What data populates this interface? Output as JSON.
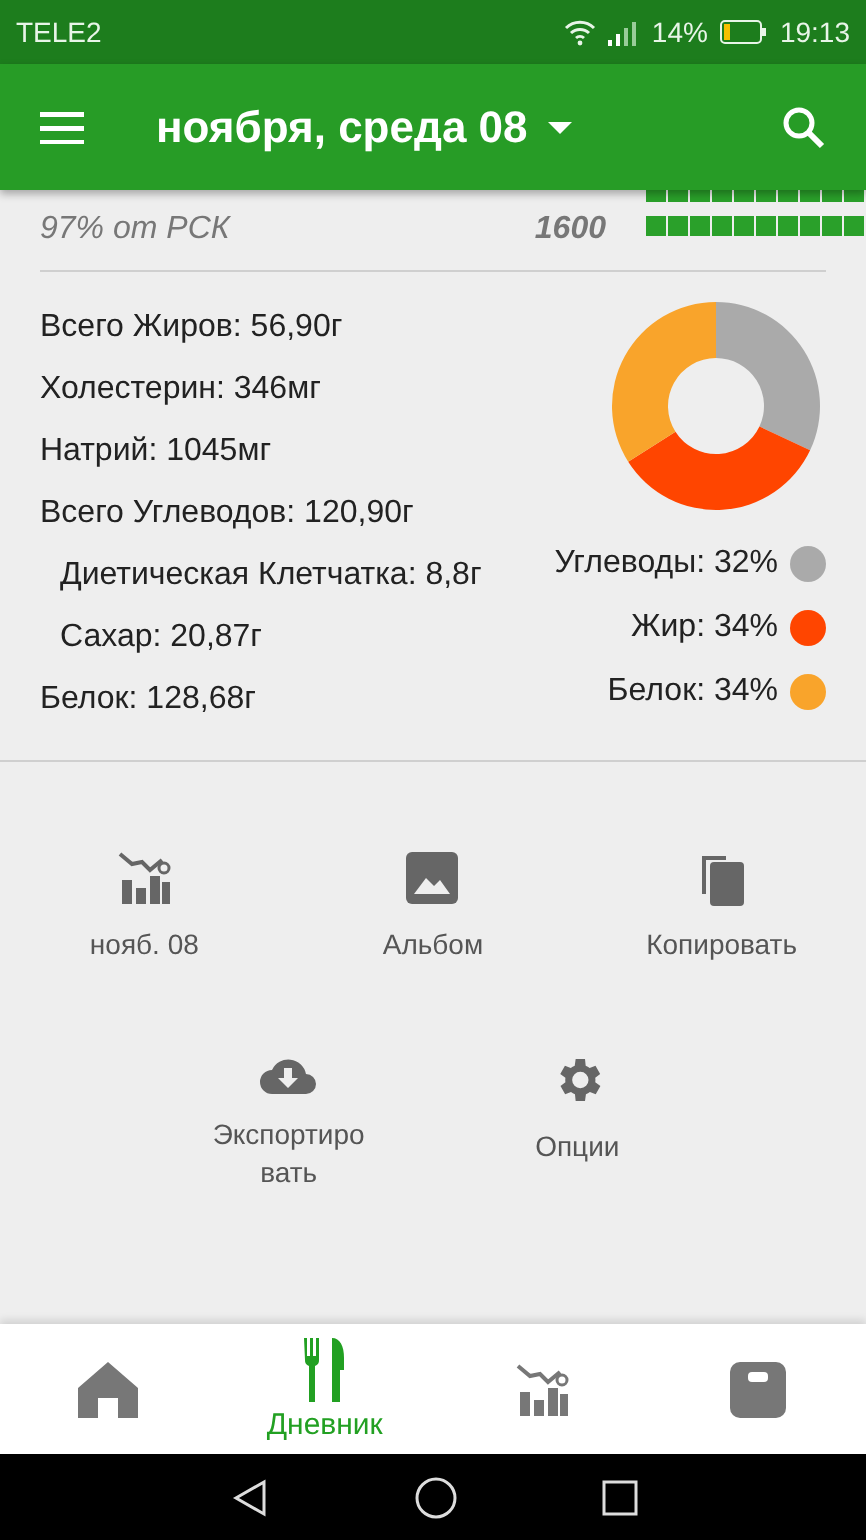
{
  "status_bar": {
    "carrier": "TELE2",
    "battery": "14%",
    "time": "19:13"
  },
  "app_bar": {
    "title": "ноября, среда 08"
  },
  "summary": {
    "percent_text": "97% от РСК",
    "calories": "1600"
  },
  "nutrients": [
    {
      "text": "Всего Жиров: 56,90г"
    },
    {
      "text": "Холестерин: 346мг"
    },
    {
      "text": "Натрий: 1045мг"
    },
    {
      "text": "Всего Углеводов: 120,90г",
      "children": [
        {
          "text": "Диетическая Клетчатка: 8,8г"
        },
        {
          "text": "Сахар: 20,87г"
        }
      ]
    },
    {
      "text": "Белок: 128,68г"
    }
  ],
  "chart_data": {
    "type": "donut",
    "values": [
      32,
      34,
      34
    ],
    "colors": [
      "#aaaaaa",
      "#ff4500",
      "#f9a42b"
    ],
    "value_labels": [
      "Углеводы: 32%",
      "Жир: 34%",
      "Белок: 34%"
    ]
  },
  "actions": [
    {
      "kind": "stats",
      "label": "нояб. 08"
    },
    {
      "kind": "album",
      "label": "Альбом"
    },
    {
      "kind": "copy",
      "label": "Копировать"
    },
    {
      "kind": "export",
      "label": "Экспортиро вать"
    },
    {
      "kind": "settings",
      "label": "Опции"
    }
  ],
  "bottom_nav": [
    {
      "kind": "home",
      "selected": false
    },
    {
      "kind": "diary",
      "label": "Дневник",
      "selected": true
    },
    {
      "kind": "stats",
      "selected": false
    },
    {
      "kind": "scale",
      "selected": false
    }
  ]
}
